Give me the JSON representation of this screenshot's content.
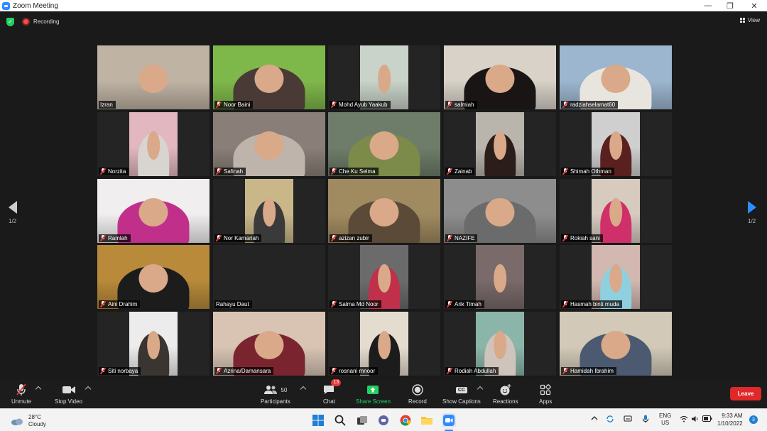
{
  "window": {
    "title": "Zoom Meeting",
    "controls": [
      "—",
      "❐",
      "✕"
    ]
  },
  "topbar": {
    "recording_label": "Recording",
    "view_label": "View"
  },
  "gallery": {
    "active_speaker_index": 0,
    "tiles": [
      {
        "name": "Izran",
        "bg": "#bfb3a4",
        "hijab": "",
        "muted": false
      },
      {
        "name": "Noor Baini",
        "bg": "#7fb84a",
        "hijab": "#4a3a35",
        "muted": true
      },
      {
        "name": "Mohd Ayub Yaakub",
        "bg": "#c9d3c9",
        "hijab": "",
        "muted": true
      },
      {
        "name": "salmiah",
        "bg": "#d8d2c8",
        "hijab": "#1a1515",
        "muted": true
      },
      {
        "name": "radziahselamat60",
        "bg": "#9db6cf",
        "hijab": "#e8e4de",
        "muted": true
      },
      {
        "name": "Norzita",
        "bg": "#e2b7bf",
        "hijab": "#d8d4d0",
        "muted": true
      },
      {
        "name": "Safinah",
        "bg": "#8a7f78",
        "hijab": "#bfb4ac",
        "muted": true
      },
      {
        "name": "Che Ku Selma",
        "bg": "#6e7d6a",
        "hijab": "#7c8a4a",
        "muted": true
      },
      {
        "name": "Zainab",
        "bg": "#b9b5ad",
        "hijab": "#2b1e1a",
        "muted": true
      },
      {
        "name": "Shimah Othman",
        "bg": "#cfcfcf",
        "hijab": "#5a2020",
        "muted": true
      },
      {
        "name": "Ramlah",
        "bg": "#f0eeee",
        "hijab": "#c0308a",
        "muted": true
      },
      {
        "name": "Nor Kamariah",
        "bg": "#c9b78a",
        "hijab": "#3a3a3a",
        "muted": true
      },
      {
        "name": "azizan zubir",
        "bg": "#a08a60",
        "hijab": "#5b4a38",
        "muted": true
      },
      {
        "name": "NAZIFE",
        "bg": "#8d8d8d",
        "hijab": "#6b6b6b",
        "muted": true
      },
      {
        "name": "Rokiah sani",
        "bg": "#d7cbc0",
        "hijab": "#d0306a",
        "muted": true
      },
      {
        "name": "Aini Drahim",
        "bg": "#b88a3a",
        "hijab": "#1c1c1c",
        "muted": true
      },
      {
        "name": "Rahayu Daut",
        "bg": "",
        "hijab": "",
        "muted": false
      },
      {
        "name": "Salma Md Noor",
        "bg": "#6b6b6b",
        "hijab": "#c0304a",
        "muted": true
      },
      {
        "name": "Arik Timah",
        "bg": "#7a6a6a",
        "hijab": "",
        "muted": true
      },
      {
        "name": "Hasmah binti muda",
        "bg": "#d2b8b0",
        "hijab": "#8fd0e0",
        "muted": true
      },
      {
        "name": "Siti norbaya",
        "bg": "#ececec",
        "hijab": "#3a3530",
        "muted": true
      },
      {
        "name": "Azrina/Damansara",
        "bg": "#d9c4b4",
        "hijab": "#7a2430",
        "muted": true
      },
      {
        "name": "rosnani mnoor",
        "bg": "#e4dccf",
        "hijab": "#1c1c1c",
        "muted": true
      },
      {
        "name": "Rodiah Abdullah",
        "bg": "#8bb5a8",
        "hijab": "#cfc4bc",
        "muted": true
      },
      {
        "name": "Hamidah Ibrahim",
        "bg": "#d2c9b8",
        "hijab": "#4b5a70",
        "muted": true
      }
    ]
  },
  "pager": {
    "left_label": "1/2",
    "right_label": "1/2"
  },
  "toolbar": {
    "unmute": "Unmute",
    "stop_video": "Stop Video",
    "participants": "Participants",
    "participants_count": "50",
    "chat": "Chat",
    "chat_badge": "13",
    "share_screen": "Share Screen",
    "record": "Record",
    "captions": "Show Captions",
    "captions_icon_text": "CC",
    "reactions": "Reactions",
    "apps": "Apps",
    "leave": "Leave"
  },
  "taskbar": {
    "weather_temp": "28°C",
    "weather_desc": "Cloudy",
    "lang_top": "ENG",
    "lang_bottom": "US",
    "time": "9:33 AM",
    "date": "1/10/2022",
    "notif_count": "3"
  }
}
